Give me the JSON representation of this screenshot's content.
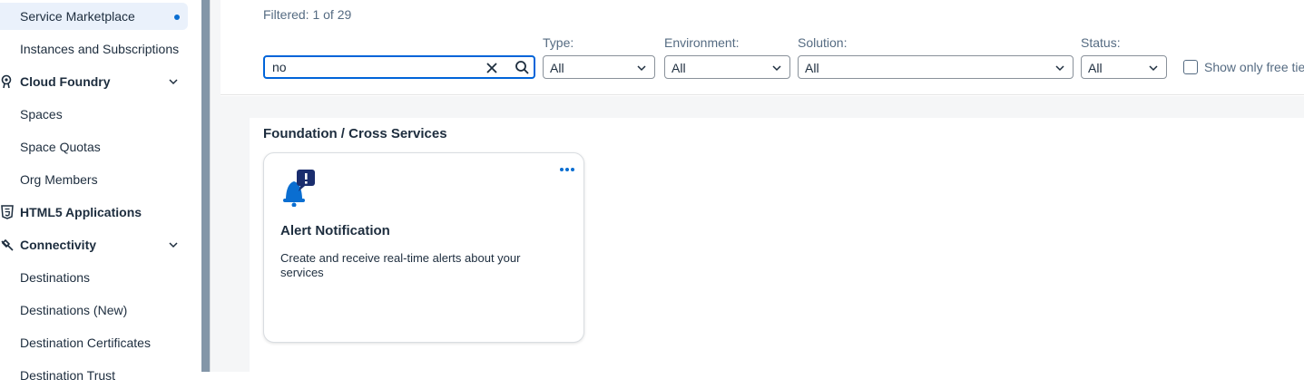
{
  "sidebar": {
    "items": [
      {
        "label": "Service Marketplace",
        "type": "sub",
        "selected": true
      },
      {
        "label": "Instances and Subscriptions",
        "type": "sub"
      },
      {
        "label": "Cloud Foundry",
        "type": "group",
        "icon": "cloud-foundry-icon",
        "expandable": true
      },
      {
        "label": "Spaces",
        "type": "sub"
      },
      {
        "label": "Space Quotas",
        "type": "sub"
      },
      {
        "label": "Org Members",
        "type": "sub"
      },
      {
        "label": "HTML5 Applications",
        "type": "group",
        "icon": "html5-icon"
      },
      {
        "label": "Connectivity",
        "type": "group",
        "icon": "connectivity-icon",
        "expandable": true
      },
      {
        "label": "Destinations",
        "type": "sub"
      },
      {
        "label": "Destinations (New)",
        "type": "sub"
      },
      {
        "label": "Destination Certificates",
        "type": "sub"
      },
      {
        "label": "Destination Trust",
        "type": "sub"
      }
    ]
  },
  "filters": {
    "filtered_text": "Filtered: 1 of 29",
    "search_value": "no",
    "type_label": "Type:",
    "type_value": "All",
    "environment_label": "Environment:",
    "environment_value": "All",
    "solution_label": "Solution:",
    "solution_value": "All",
    "status_label": "Status:",
    "status_value": "All",
    "free_tier_label": "Show only free tier"
  },
  "section": {
    "title": "Foundation / Cross Services",
    "cards": [
      {
        "title": "Alert Notification",
        "description": "Create and receive real-time alerts about your services",
        "icon": "alert-bell-icon"
      }
    ]
  },
  "colors": {
    "accent": "#0a6ed1",
    "focus_border": "#0064d9",
    "splitter": "#8396a8",
    "content_bg": "#f5f6f7"
  }
}
